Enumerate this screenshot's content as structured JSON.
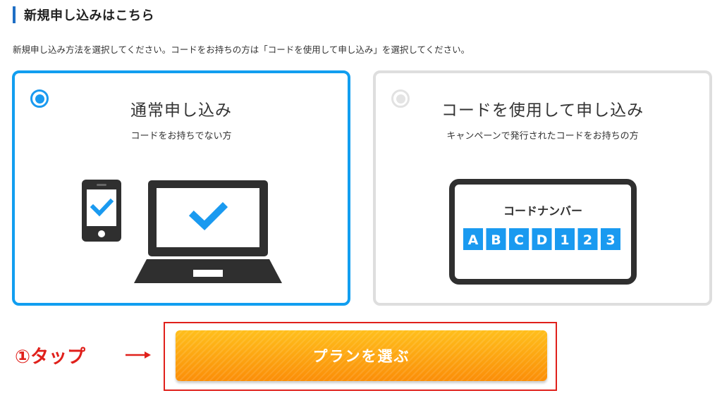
{
  "section": {
    "title": "新規申し込みはこちら",
    "description": "新規申し込み方法を選択してください。コードをお持ちの方は「コードを使用して申し込み」を選択してください。"
  },
  "options": [
    {
      "title": "通常申し込み",
      "subtitle": "コードをお持ちでない方",
      "selected": true,
      "illustration": "smartphone-and-laptop-check-icons"
    },
    {
      "title": "コードを使用して申し込み",
      "subtitle": "キャンペーンで発行されたコードをお持ちの方",
      "selected": false,
      "code_label": "コードナンバー",
      "code_chars": [
        "A",
        "B",
        "C",
        "D",
        "1",
        "2",
        "3"
      ]
    }
  ],
  "cta": {
    "label": "プランを選ぶ"
  },
  "annotation": {
    "text": "①タップ",
    "arrow": "right-arrow-icon"
  },
  "colors": {
    "accent_blue": "#119ef0",
    "heading_bar": "#1f6fc5",
    "code_box_blue": "#1a9af0",
    "cta_orange_top": "#ffbf1c",
    "cta_orange_bottom": "#fb8e08",
    "annotation_red": "#e0201b",
    "unselected_border": "#dedede"
  }
}
